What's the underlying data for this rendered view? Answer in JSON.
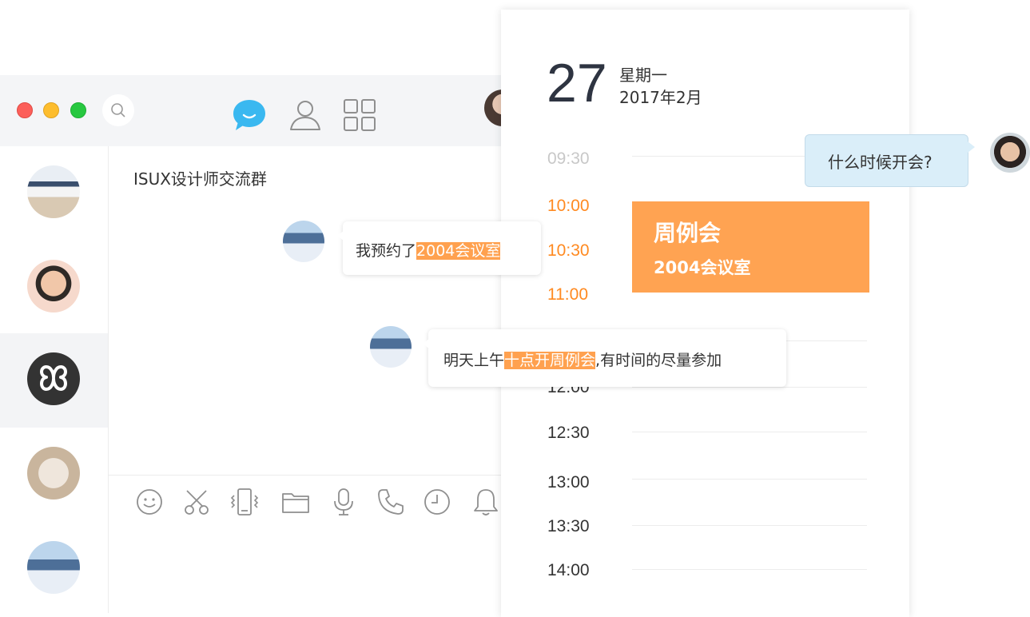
{
  "chat": {
    "group_title": "ISUX设计师交流群",
    "messages": [
      {
        "before": "我预约了",
        "highlight": "2004会议室",
        "after": ""
      },
      {
        "before": "明天上午",
        "highlight": "十点开周例会",
        "after": ",有时间的尽量参加"
      }
    ],
    "toolbar_icons": [
      "emoji-icon",
      "scissors-icon",
      "vibrate-icon",
      "folder-icon",
      "microphone-icon",
      "phone-icon",
      "clock-icon",
      "bell-icon"
    ]
  },
  "calendar": {
    "day": "27",
    "weekday": "星期一",
    "year_month": "2017年2月",
    "slots": [
      "09:30",
      "10:00",
      "10:30",
      "11:00",
      "12:00",
      "12:30",
      "13:00",
      "13:30",
      "14:00"
    ],
    "event": {
      "title": "周例会",
      "room": "2004会议室"
    }
  },
  "question": "什么时候开会?",
  "colors": {
    "accent": "#ffa352",
    "accent_text": "#ff8a21",
    "question_bg": "#daeef9",
    "chat_icon": "#3ab8f0"
  }
}
